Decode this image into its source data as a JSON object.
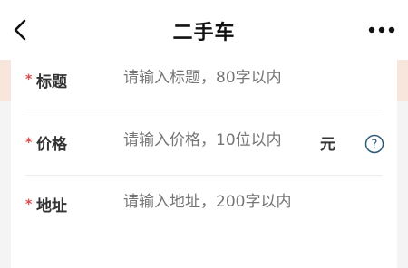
{
  "header": {
    "title": "二手车",
    "back_icon": "back-chevron-icon",
    "more_icon": "more-dots-icon"
  },
  "form": {
    "title_field": {
      "required_mark": "*",
      "label": "标题",
      "placeholder": "请输入标题，80字以内",
      "value": ""
    },
    "price_field": {
      "required_mark": "*",
      "label": "价格",
      "placeholder": "请输入价格，10位以内",
      "value": "",
      "unit": "元",
      "help_icon": "question-circle-icon"
    },
    "address_field": {
      "required_mark": "*",
      "label": "地址",
      "placeholder": "请输入地址，200字以内",
      "value": ""
    }
  },
  "colors": {
    "required": "#e0484a",
    "placeholder": "#bdbdbd",
    "band": "#f8e6dc",
    "help_icon": "#2f5b7a"
  }
}
